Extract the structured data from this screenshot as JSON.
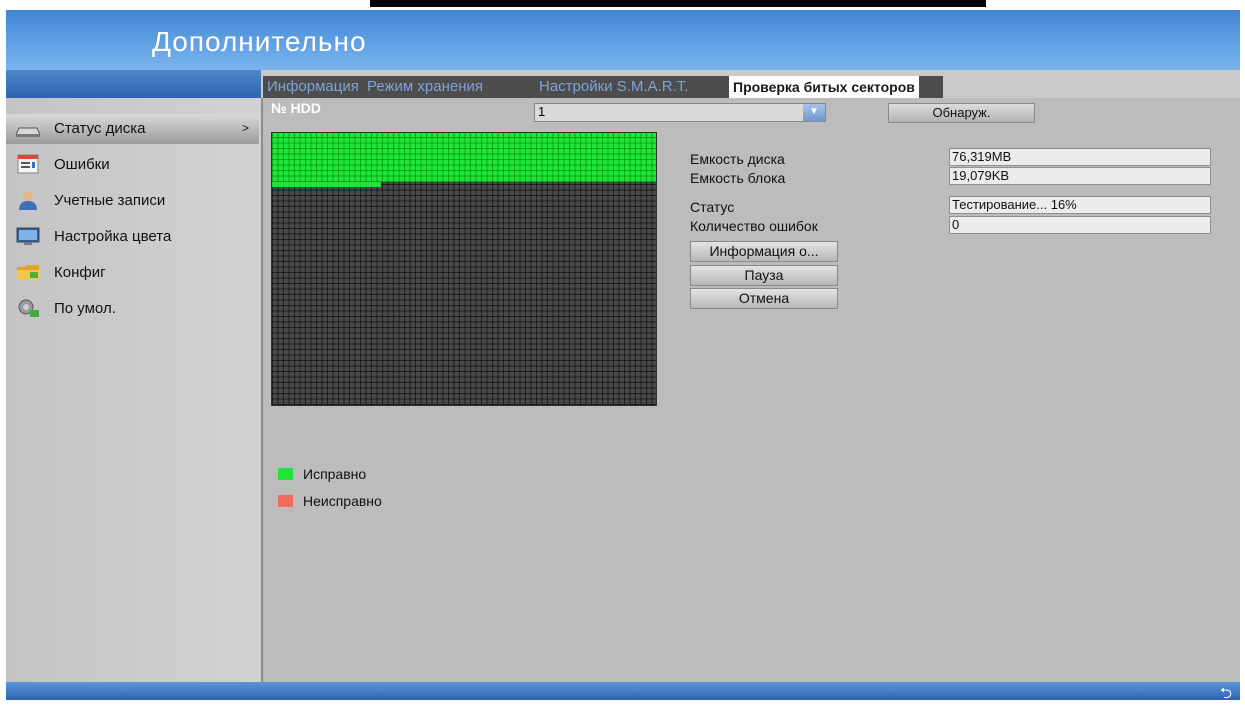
{
  "header": {
    "title": "Дополнительно"
  },
  "tabs": [
    {
      "label": "Информация"
    },
    {
      "label": "Режим хранения"
    },
    {
      "label": "Настройки S.M.A.R.T."
    },
    {
      "label": "Проверка битых секторов"
    }
  ],
  "sidebar": {
    "items": [
      {
        "label": "Статус диска",
        "icon": "hdd-icon",
        "selected": true,
        "arrow": ">"
      },
      {
        "label": "Ошибки",
        "icon": "error-list-icon"
      },
      {
        "label": "Учетные записи",
        "icon": "user-icon"
      },
      {
        "label": "Настройка цвета",
        "icon": "monitor-icon"
      },
      {
        "label": "Конфиг",
        "icon": "folder-icon"
      },
      {
        "label": "По умол.",
        "icon": "reset-icon"
      }
    ]
  },
  "hdd": {
    "label": "№ HDD",
    "selected_value": "1",
    "detect_button": "Обнаруж."
  },
  "info": {
    "capacity_label": "Емкость диска",
    "capacity_value": "76,319MB",
    "block_label": "Емкость блока",
    "block_value": "19,079KB",
    "status_label": "Статус",
    "status_value": "Тестирование... 16%",
    "errors_label": "Количество ошибок",
    "errors_value": "0"
  },
  "actions": {
    "info_button": "Информация о...",
    "pause_button": "Пауза",
    "cancel_button": "Отмена"
  },
  "scan": {
    "progress_percent": 16
  },
  "legend": {
    "good_label": "Исправно",
    "bad_label": "Неисправно",
    "good_color": "#1fe53a",
    "bad_color": "#f06a5e"
  },
  "footer": {
    "back_icon": "return-arrow-icon"
  }
}
